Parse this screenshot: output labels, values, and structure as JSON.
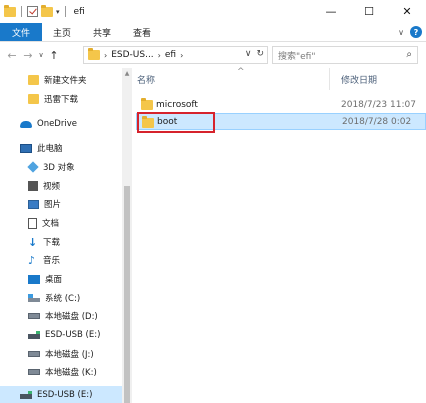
{
  "window": {
    "title": "efi",
    "controls": {
      "minimize": "—",
      "maximize": "☐",
      "close": "✕"
    }
  },
  "ribbon": {
    "tabs": [
      "文件",
      "主页",
      "共享",
      "查看"
    ],
    "collapse_glyph": "∨",
    "help_glyph": "?"
  },
  "nav": {
    "back_glyph": "←",
    "forward_glyph": "→",
    "recent_glyph": "∨",
    "up_glyph": "↑",
    "breadcrumb": [
      "ESD-US...",
      "efi"
    ],
    "dropdown_glyph": "∨",
    "refresh_glyph": "↻",
    "search_placeholder": "搜索\"efi\"",
    "search_glyph": "⌕"
  },
  "sidebar": {
    "items": [
      {
        "label": "新建文件夹",
        "icon": "folder-icon"
      },
      {
        "label": "迅雷下载",
        "icon": "folder-icon"
      },
      {
        "label": "OneDrive",
        "icon": "cloud-icon"
      },
      {
        "label": "此电脑",
        "icon": "computer-icon"
      },
      {
        "label": "3D 对象",
        "icon": "3d-objects-icon"
      },
      {
        "label": "视频",
        "icon": "video-icon"
      },
      {
        "label": "图片",
        "icon": "pictures-icon"
      },
      {
        "label": "文档",
        "icon": "documents-icon"
      },
      {
        "label": "下载",
        "icon": "download-icon"
      },
      {
        "label": "音乐",
        "icon": "music-icon"
      },
      {
        "label": "桌面",
        "icon": "desktop-icon"
      },
      {
        "label": "系统 (C:)",
        "icon": "system-drive-icon"
      },
      {
        "label": "本地磁盘 (D:)",
        "icon": "drive-icon"
      },
      {
        "label": "ESD-USB (E:)",
        "icon": "usb-drive-icon"
      },
      {
        "label": "本地磁盘 (J:)",
        "icon": "drive-icon"
      },
      {
        "label": "本地磁盘 (K:)",
        "icon": "drive-icon"
      },
      {
        "label": "ESD-USB (E:)",
        "icon": "usb-drive-icon"
      }
    ]
  },
  "list": {
    "columns": {
      "name": "名称",
      "modified": "修改日期"
    },
    "sort_caret": "^",
    "rows": [
      {
        "name": "microsoft",
        "modified": "2018/7/23 11:07"
      },
      {
        "name": "boot",
        "modified": "2018/7/28 0:02"
      }
    ]
  },
  "scrollbar": {
    "up_glyph": "▲",
    "down_glyph": "▼"
  }
}
